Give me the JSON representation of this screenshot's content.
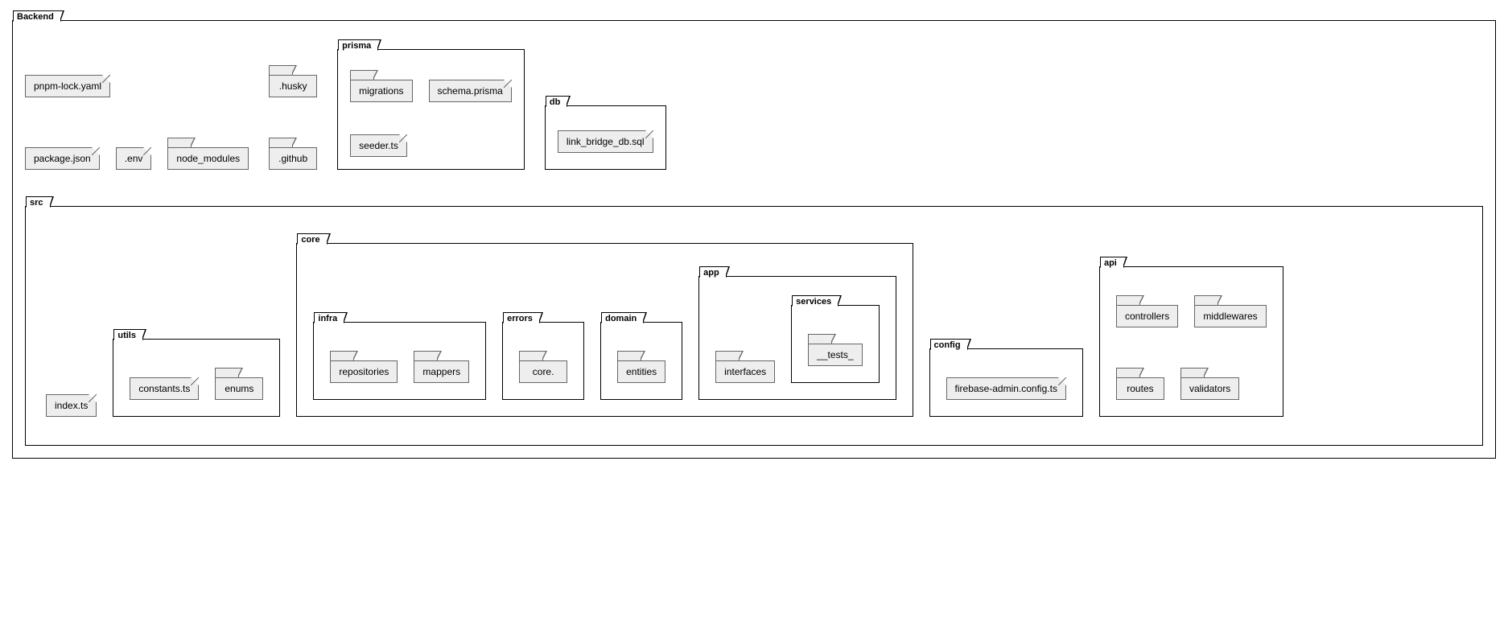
{
  "root": {
    "label": "Backend",
    "files_row1": {
      "pnpm_lock": "pnpm-lock.yaml",
      "husky": ".husky"
    },
    "files_row2": {
      "package_json": "package.json",
      "env": ".env",
      "node_modules": "node_modules",
      "github": ".github"
    },
    "prisma": {
      "label": "prisma",
      "migrations": "migrations",
      "schema": "schema.prisma",
      "seeder": "seeder.ts"
    },
    "db": {
      "label": "db",
      "sql": "link_bridge_db.sql"
    },
    "src": {
      "label": "src",
      "index": "index.ts",
      "utils": {
        "label": "utils",
        "constants": "constants.ts",
        "enums": "enums"
      },
      "core": {
        "label": "core",
        "infra": {
          "label": "infra",
          "repositories": "repositories",
          "mappers": "mappers"
        },
        "errors": {
          "label": "errors",
          "core": "core."
        },
        "domain": {
          "label": "domain",
          "entities": "entities"
        },
        "app": {
          "label": "app",
          "interfaces": "interfaces",
          "services": {
            "label": "services",
            "tests": "__tests_"
          }
        }
      },
      "config": {
        "label": "config",
        "firebase": "firebase-admin.config.ts"
      },
      "api": {
        "label": "api",
        "controllers": "controllers",
        "middlewares": "middlewares",
        "routes": "routes",
        "validators": "validators"
      }
    }
  }
}
